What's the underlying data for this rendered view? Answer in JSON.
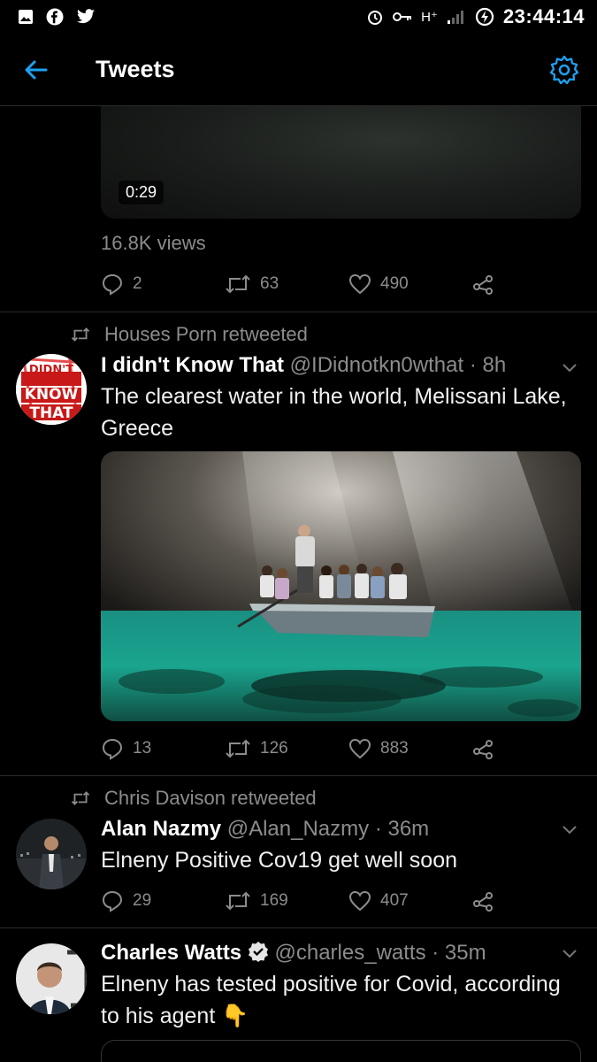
{
  "status_bar": {
    "time": "23:44:14",
    "network": "H⁺"
  },
  "app_bar": {
    "title": "Tweets"
  },
  "tweet1": {
    "video_duration": "0:29",
    "views": "16.8K views",
    "replies": "2",
    "retweets": "63",
    "likes": "490"
  },
  "tweet2": {
    "retweeted_by": "Houses Porn retweeted",
    "avatar_text": "DIDN'T KNOW THAT",
    "name": "I didn't Know That",
    "handle": "@IDidnotkn0wthat",
    "time": "· 8h",
    "text": "The clearest water in the world, Melissani Lake, Greece",
    "replies": "13",
    "retweets": "126",
    "likes": "883"
  },
  "tweet3": {
    "retweeted_by": "Chris Davison retweeted",
    "name": "Alan Nazmy",
    "handle": "@Alan_Nazmy",
    "time": "· 36m",
    "text": "Elneny Positive Cov19 get well soon",
    "replies": "29",
    "retweets": "169",
    "likes": "407"
  },
  "tweet4": {
    "name": "Charles Watts",
    "handle": "@charles_watts",
    "time": "· 35m",
    "text": "Elneny has tested positive for Covid, according to his agent 👇"
  },
  "colors": {
    "accent": "#1da1f2",
    "muted": "#8c8c8c",
    "background": "#000000"
  }
}
